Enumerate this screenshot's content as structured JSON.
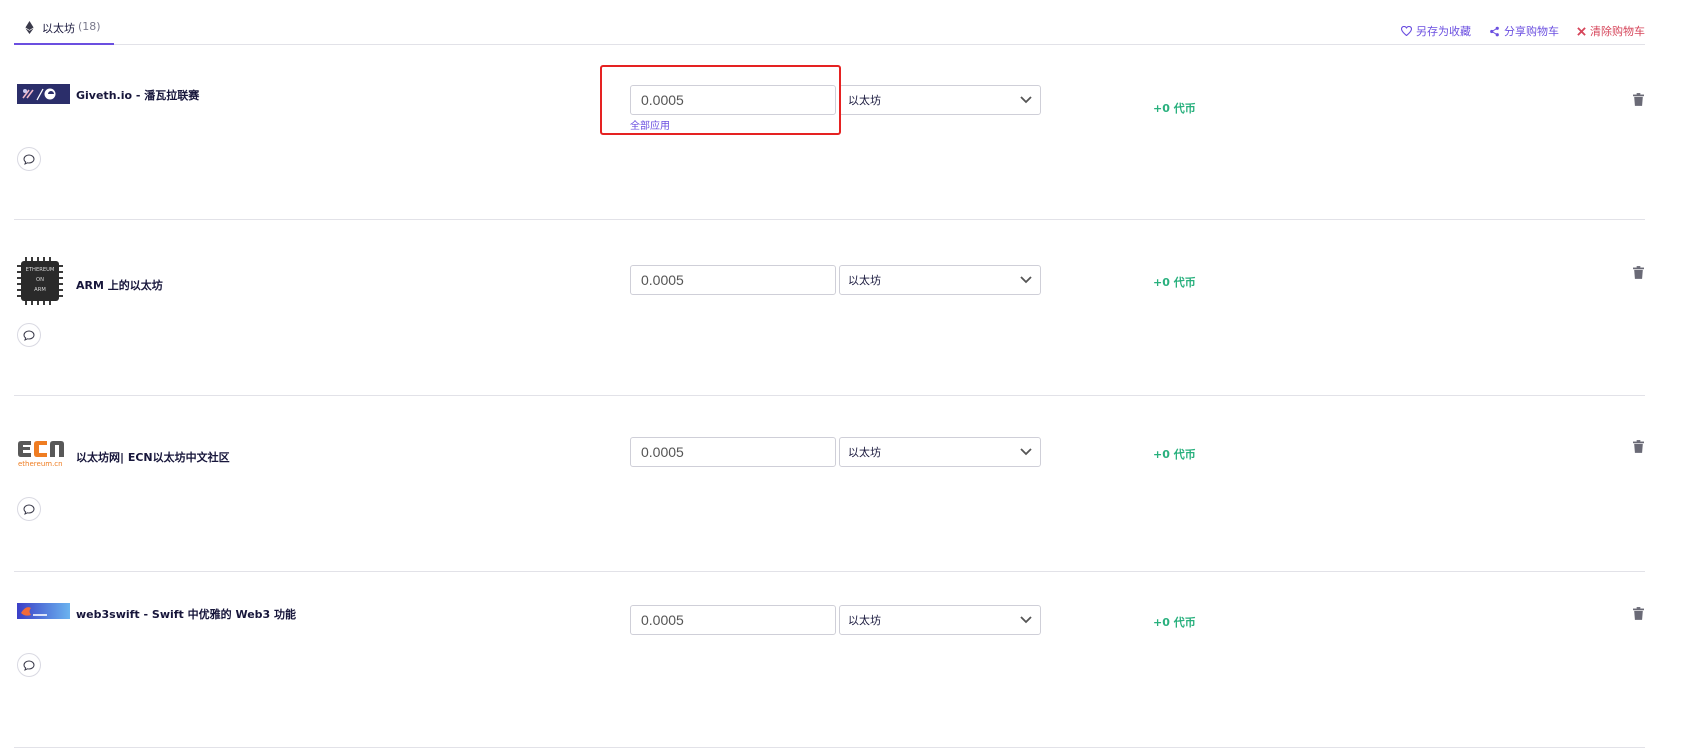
{
  "tab": {
    "label": "以太坊",
    "count": "(18)"
  },
  "actions": {
    "save": "另存为收藏",
    "share": "分享购物车",
    "clear": "清除购物车"
  },
  "items": [
    {
      "title": "Giveth.io - 潘瓦拉联赛",
      "amount": "0.0005",
      "currency": "以太坊",
      "tokens": "+0 代币",
      "apply_all": "全部应用"
    },
    {
      "title": "ARM 上的以太坊",
      "amount": "0.0005",
      "currency": "以太坊",
      "tokens": "+0 代币",
      "logo_lines": [
        "ETHEREUM",
        "ON",
        "ARM"
      ]
    },
    {
      "title": "以太坊网| ECN以太坊中文社区",
      "amount": "0.0005",
      "currency": "以太坊",
      "tokens": "+0 代币",
      "logo_text": "ethereum.cn"
    },
    {
      "title": "web3swift - Swift 中优雅的 Web3 功能",
      "amount": "0.0005",
      "currency": "以太坊",
      "tokens": "+0 代币"
    }
  ],
  "colors": {
    "accent": "#6b4fe0",
    "danger": "#d6455a",
    "positive": "#28b07d",
    "highlight": "#e52222"
  }
}
